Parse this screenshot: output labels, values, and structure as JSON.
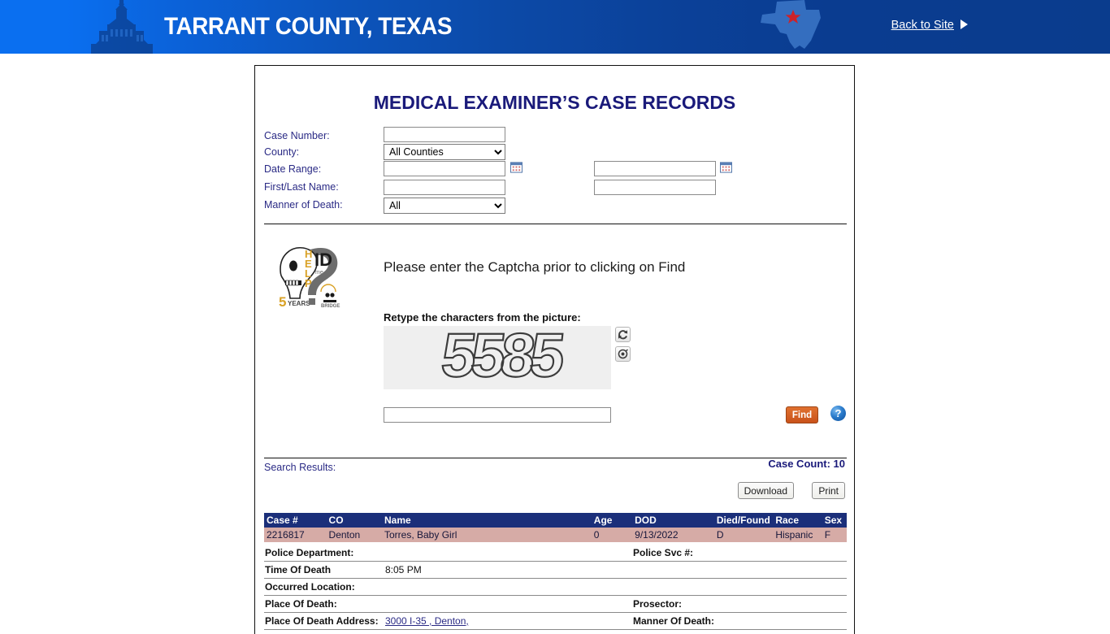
{
  "banner": {
    "title": "TARRANT COUNTY, TEXAS",
    "back_link": "Back to Site",
    "bg_color_left": "#0a6ff0",
    "bg_color_right": "#0a3c8d",
    "star_color": "#cc2229"
  },
  "page": {
    "title": "MEDICAL EXAMINER’S CASE RECORDS"
  },
  "search_form": {
    "fields": [
      {
        "label": "Case Number:",
        "type": "text",
        "value": ""
      },
      {
        "label": "County:",
        "type": "select",
        "value": "All Counties"
      },
      {
        "label": "Date Range:",
        "type": "text",
        "value": ""
      },
      {
        "label": "First/Last Name:",
        "type": "text",
        "value": ""
      },
      {
        "label": "Manner of Death:",
        "type": "select",
        "value": "All"
      }
    ],
    "date_range_to_value": "",
    "last_name_value": "",
    "county_options": [
      "All Counties"
    ],
    "manner_options": [
      "All"
    ],
    "calendar_icon": "calendar-icon"
  },
  "captcha": {
    "logo_alt": "help-id-me-logo",
    "logo_text_help": "HELP",
    "logo_text_id": "ID",
    "logo_text_me": "me",
    "logo_years": "5",
    "logo_years_label": "YEARS",
    "notice": "Please enter the Captcha prior to clicking on Find",
    "retype_label": "Retype the characters from the picture:",
    "code": "5585",
    "input_value": "",
    "refresh_icon": "refresh-icon",
    "audio_icon": "audio-icon",
    "find_label": "Find",
    "find_color": "#cc5c22",
    "help_icon": "help-question-icon",
    "help_glyph": "?"
  },
  "results": {
    "label": "Search Results:",
    "case_count_text": "Case Count: 10",
    "case_count": 10,
    "download_label": "Download",
    "print_label": "Print",
    "columns": [
      "Case #",
      "CO",
      "Name",
      "Age",
      "DOD",
      "Died/Found",
      "Race",
      "Sex"
    ],
    "rows": [
      {
        "case_number": "2216817",
        "co": "Denton",
        "name": "Torres, Baby Girl",
        "age": "0",
        "dod": "9/13/2022",
        "died_found": "D",
        "race": "Hispanic",
        "sex": "F"
      }
    ],
    "row_highlight_color": "#d6aba6",
    "header_color": "#1b2f7a"
  },
  "case_detail": {
    "police_department_label": "Police Department:",
    "police_department_value": "",
    "police_svc_label": "Police Svc #:",
    "police_svc_value": "",
    "time_of_death_label": "Time Of Death",
    "time_of_death_value": "8:05 PM",
    "occurred_location_label": "Occurred Location:",
    "occurred_location_value": "",
    "place_of_death_label": "Place Of Death:",
    "place_of_death_value": "",
    "prosector_label": "Prosector:",
    "prosector_value": "",
    "place_of_death_address_label": "Place Of Death Address:",
    "place_of_death_address_value": "3000 I-35 , Denton,",
    "manner_of_death_label": "Manner Of Death:",
    "manner_of_death_value": ""
  }
}
